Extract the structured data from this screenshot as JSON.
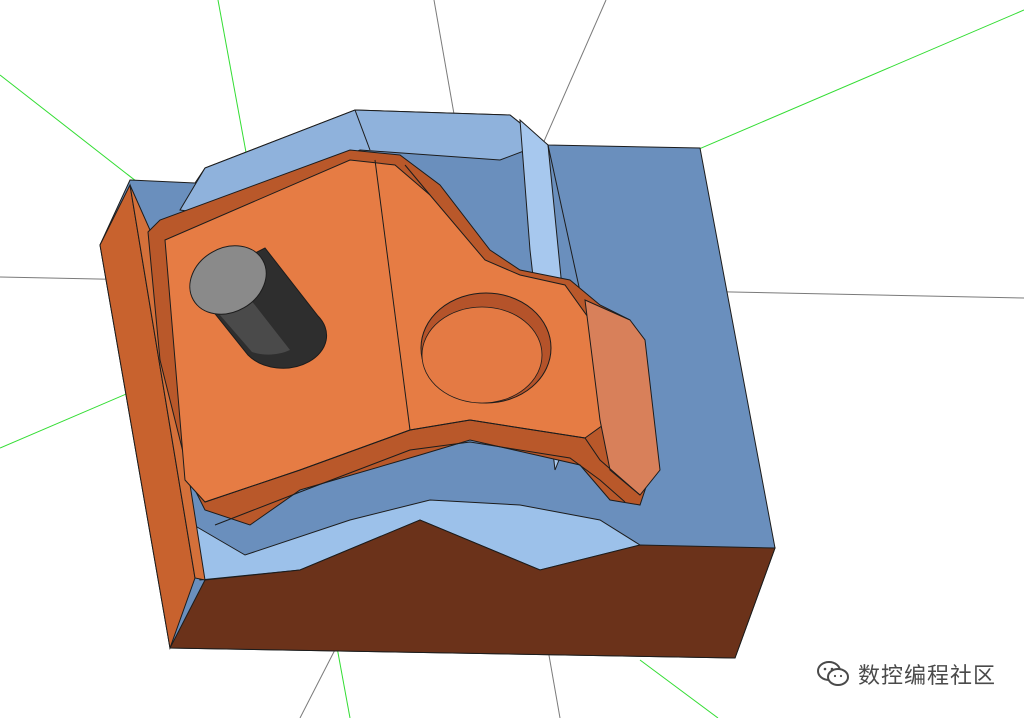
{
  "scene": {
    "description_hidden": false,
    "background_color": "#ffffff",
    "colors": {
      "mold_block": "#6a8fbd",
      "mold_block_light": "#9cc1ea",
      "mold_block_dark": "#4d6f99",
      "part_orange": "#e67c44",
      "part_orange_dark": "#b9582a",
      "part_side_brown": "#6b321a",
      "pin_dark": "#3a3a3a",
      "axis_green": "#33dd33",
      "axis_gray": "#777777"
    }
  },
  "watermark": {
    "icon": "wechat-icon",
    "text": "数控编程社区"
  }
}
